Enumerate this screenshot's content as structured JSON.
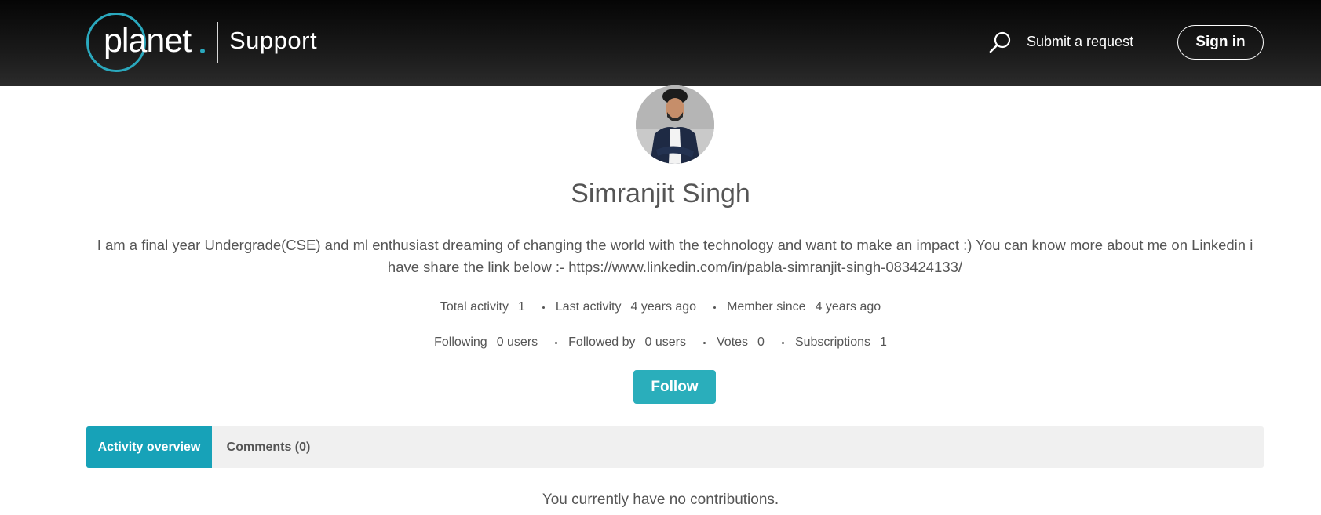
{
  "header": {
    "logo_text": "planet",
    "brand_section": "Support",
    "search_icon": "search-icon",
    "submit_request_label": "Submit a request",
    "sign_in_label": "Sign in",
    "colors": {
      "accent": "#2aa8bd",
      "header_bg": "#111111"
    }
  },
  "profile": {
    "avatar_icon": "user-avatar",
    "name": "Simranjit Singh",
    "bio": "I am a final year Undergrade(CSE) and ml enthusiast dreaming of changing the world with the technology and want to make an impact :) You can know more about me on Linkedin i have share the link below :- https://www.linkedin.com/in/pabla-simranjit-singh-083424133/",
    "stats_row1": [
      {
        "label": "Total activity",
        "value": "1"
      },
      {
        "label": "Last activity",
        "value": "4 years ago"
      },
      {
        "label": "Member since",
        "value": "4 years ago"
      }
    ],
    "stats_row2": [
      {
        "label": "Following",
        "value": "0 users"
      },
      {
        "label": "Followed by",
        "value": "0 users"
      },
      {
        "label": "Votes",
        "value": "0"
      },
      {
        "label": "Subscriptions",
        "value": "1"
      }
    ],
    "follow_label": "Follow",
    "follow_color": "#2aaebb"
  },
  "tabs": [
    {
      "label": "Activity overview",
      "active": true
    },
    {
      "label": "Comments (0)",
      "active": false
    }
  ],
  "activity": {
    "empty_message": "You currently have no contributions."
  }
}
